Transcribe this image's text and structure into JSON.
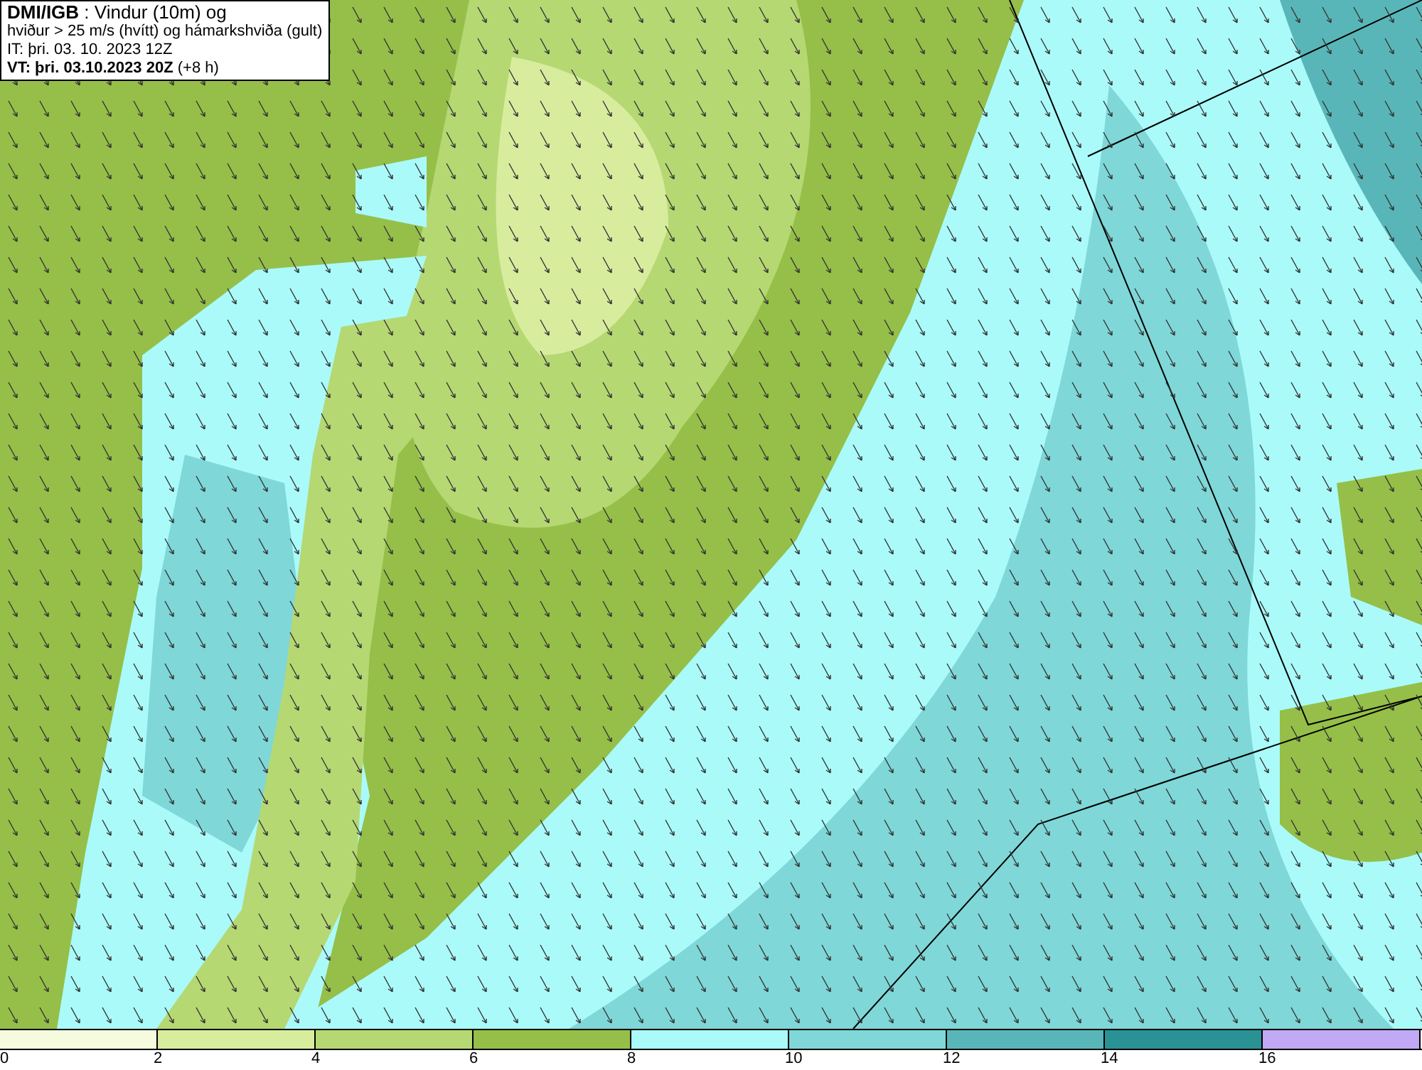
{
  "header": {
    "lines": [
      "**DMI/IGB** : Vindur (10m) og",
      "hviður > 25 m/s (hvítt) og hámarkshviða (gult)",
      "IT: þri. 03. 10. 2023 12Z",
      "**VT: þri. 03.10.2023 20Z** (+8 h)"
    ]
  },
  "legend": {
    "segments": [
      {
        "color": "#f5fbdf"
      },
      {
        "color": "#d8ec9e"
      },
      {
        "color": "#b5d873"
      },
      {
        "color": "#95bf48"
      },
      {
        "color": "#aafafa"
      },
      {
        "color": "#7fd7d8"
      },
      {
        "color": "#59b6b8"
      },
      {
        "color": "#2a9294"
      },
      {
        "color": "#c1a9f5"
      }
    ],
    "ticks": [
      "0",
      "2",
      "4",
      "6",
      "8",
      "10",
      "12",
      "14",
      "16"
    ]
  }
}
